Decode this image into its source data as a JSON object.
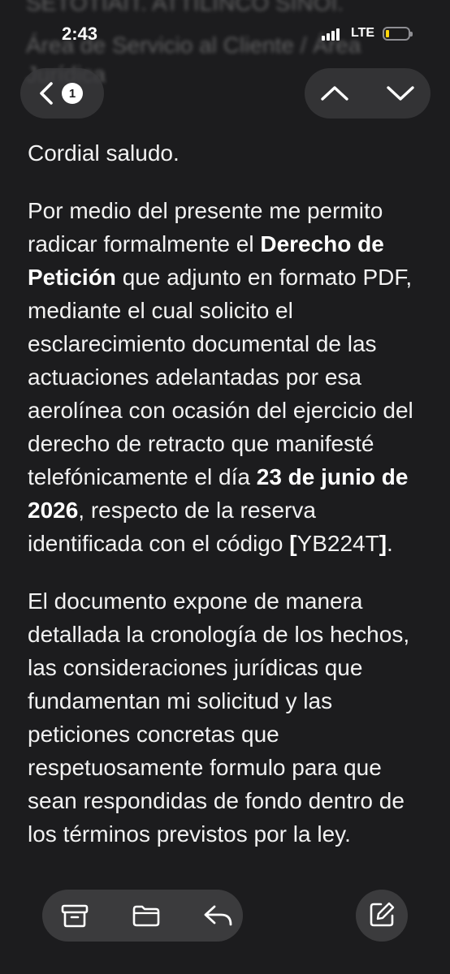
{
  "status_bar": {
    "time": "2:43",
    "network": "LTE",
    "battery_level": 0.1,
    "battery_color": "#ffd60a"
  },
  "header_blurred": {
    "line1": "SETOTIAIT. ATTILINCO SINOI.",
    "line2": "Área de Servicio al Cliente / Área",
    "line3": "Jurídica"
  },
  "nav": {
    "unread_count": "1",
    "back_icon": "chevron-left-icon",
    "up_icon": "chevron-up-icon",
    "down_icon": "chevron-down-icon"
  },
  "message": {
    "greeting": "Cordial saludo.",
    "p2_a": "Por medio del presente me permito radicar formalmente el ",
    "p2_b": "Derecho de Petición",
    "p2_c": " que adjunto en formato PDF, mediante el cual solicito el esclarecimiento documental de las actuaciones adelantadas por esa aerolínea con ocasión del ejercicio del derecho de retracto que manifesté telefónicamente el día ",
    "p2_d": "23 de junio de 2026",
    "p2_e": ", respecto de la reserva identificada con el código ",
    "p2_f": "[",
    "p2_g": "YB224T",
    "p2_h": "]",
    "p2_i": ".",
    "p3": "El documento expone de manera detallada la cronología de los hechos, las consideraciones jurídicas que fundamentan mi solicitud y las peticiones concretas que respetuosamente formulo para que sean respondidas de fondo dentro de los términos previstos por la ley."
  },
  "toolbar": {
    "archive_icon": "archive-icon",
    "folder_icon": "folder-icon",
    "reply_icon": "reply-icon",
    "compose_icon": "compose-icon"
  }
}
